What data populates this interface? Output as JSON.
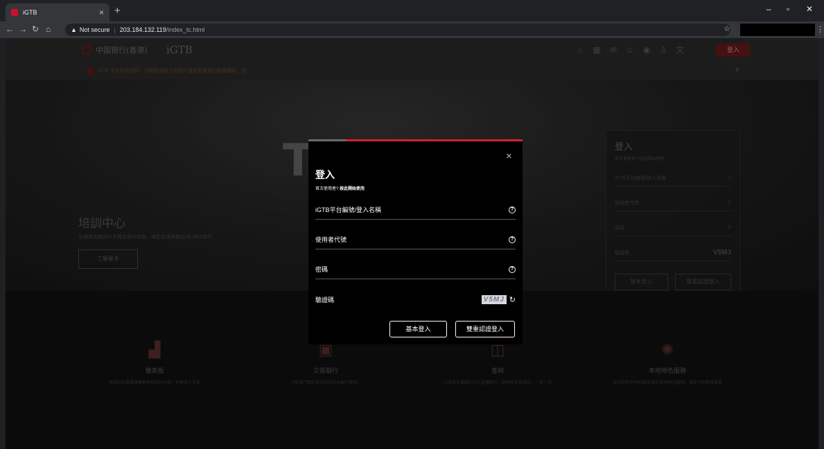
{
  "browser": {
    "tab_title": "iGTB",
    "tab_close": "×",
    "new_tab": "+",
    "minimize": "–",
    "maximize": "▫",
    "close": "✕",
    "not_secure": "Not secure",
    "url_host": "203.184.132.119",
    "url_path": "/index_tc.html"
  },
  "site": {
    "logo_text": "中国银行(香港)",
    "brand": "iGTB",
    "header_login": "登入",
    "notice": "iGTB 平台升級通知：中銀香港致力為客戶提供更優質的服務體驗，由..."
  },
  "hero": {
    "big_text": "T  NG",
    "title": "培訓中心",
    "subtitle": "這裡有各類用戶手冊及操作指南，讓您快速掌握iGTB NET操作",
    "button": "了解更多"
  },
  "side_login": {
    "title": "登入",
    "subtitle": "首次使用者? 按此開始使用",
    "fields": [
      "iGTB平台編號/登入名稱",
      "使用者代號",
      "密碼",
      "驗證碼"
    ],
    "captcha": "V5MJ",
    "basic_login": "基本登入",
    "dual_login": "雙重認證登入"
  },
  "services": [
    {
      "title": "儀表板",
      "desc": "根據您的需要建構儀表板賬戶內容，快捷進入交易",
      "icon": "chart-icon"
    },
    {
      "title": "交易銀行",
      "desc": "了解各門類交易及您的交易銀行業務。",
      "icon": "bank-icon"
    },
    {
      "title": "查詢",
      "desc": "以簡易及直觀的方式查閱賬戶、餘額及交易資訊，一目了然",
      "icon": "search-icon"
    },
    {
      "title": "本地特色服務",
      "desc": "為您提供不同地域/地區的本地特色服務，滿足不同業務需要",
      "icon": "network-icon"
    }
  ],
  "modal": {
    "close": "×",
    "title": "登入",
    "subtitle_prefix": "首次使用者? ",
    "subtitle_link": "按此開始使用",
    "fields": {
      "platform_id": "iGTB平台編號/登入名稱",
      "user_code": "使用者代號",
      "password": "密碼",
      "captcha": "驗證碼"
    },
    "captcha_text": "V5MJ",
    "basic_login": "基本登入",
    "dual_login": "雙重認證登入"
  }
}
